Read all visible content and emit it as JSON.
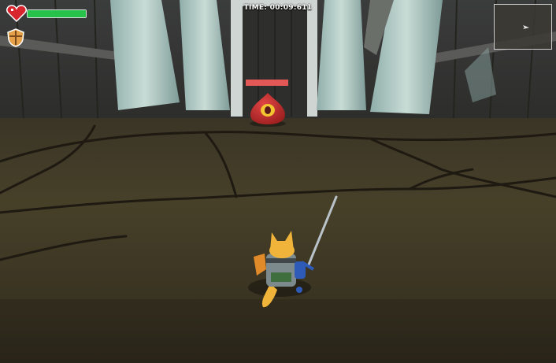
{
  "hud": {
    "timer": "TIME: 00:09:611",
    "player_health": 1.0,
    "enemy_health": 1.0
  },
  "colors": {
    "health_fill": "#27c24a",
    "enemy_health_fill": "#e35757",
    "heart": "#d8242c",
    "slime": "#c93030",
    "eye": "#f2c531",
    "player_fur": "#f0b43a",
    "armor": "#7c8a8e"
  },
  "icons": {
    "health": "heart-icon",
    "defense": "shield-icon",
    "minimap_player": "player-arrow-icon"
  }
}
